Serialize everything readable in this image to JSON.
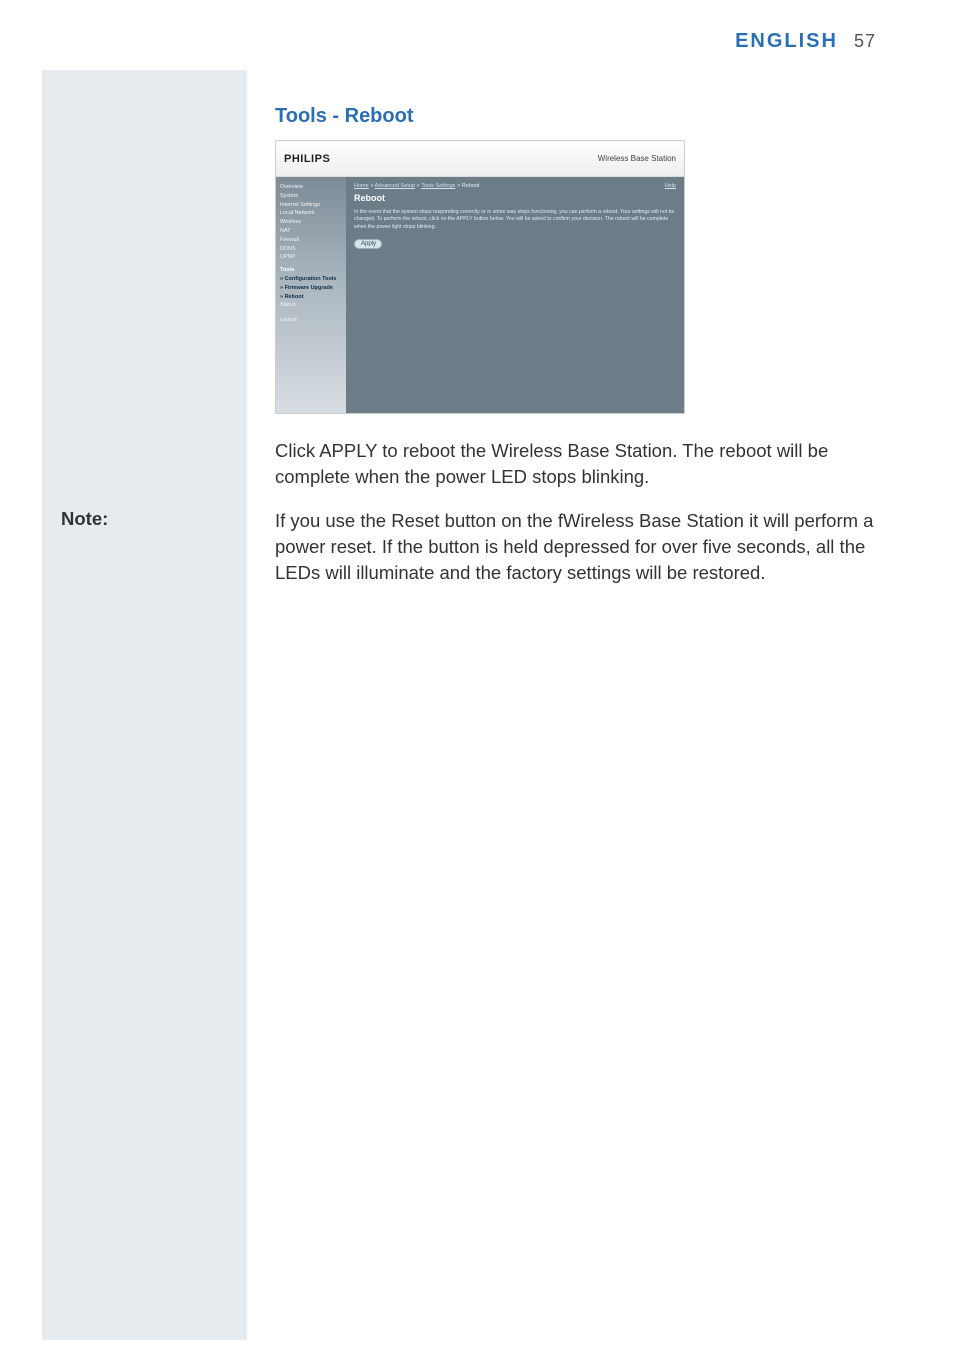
{
  "header": {
    "language": "ENGLISH",
    "page_number": "57"
  },
  "page": {
    "section_title": "Tools - Reboot",
    "note_label": "Note:",
    "paragraph1": "Click APPLY to reboot the Wireless Base Station. The reboot will be complete when the power LED stops blinking.",
    "paragraph2": "If you use the Reset button on the fWireless Base Station it will perform a power reset. If the button is held depressed for over five seconds, all the LEDs will illuminate and the factory settings will be restored."
  },
  "screenshot": {
    "logo": "PHILIPS",
    "product": "Wireless Base Station",
    "help_label": "Help",
    "nav": [
      "Overview",
      "System",
      "Internet Settings",
      "Local Network",
      "Wireless",
      "NAT",
      "Firewall",
      "DDNS",
      "UPNP"
    ],
    "nav_group": "Tools",
    "nav_sub": [
      "» Configuration Tools",
      "» Firmware Upgrade",
      "» Reboot"
    ],
    "nav_tail": [
      "Status",
      "Logout"
    ],
    "breadcrumb": {
      "home": "Home",
      "sep": " > ",
      "l1": "Advanced Setup",
      "l2": "Tools Settings",
      "l3": "Reboot"
    },
    "content": {
      "title": "Reboot",
      "text": "In the event that the system stops responding correctly or in some way stops functioning, you can perform a reboot. Your settings will not be changed. To perform the reboot, click on the APPLY button below. You will be asked to confirm your decision. The reboot will be complete when the power light stops blinking.",
      "apply": "Apply"
    }
  }
}
